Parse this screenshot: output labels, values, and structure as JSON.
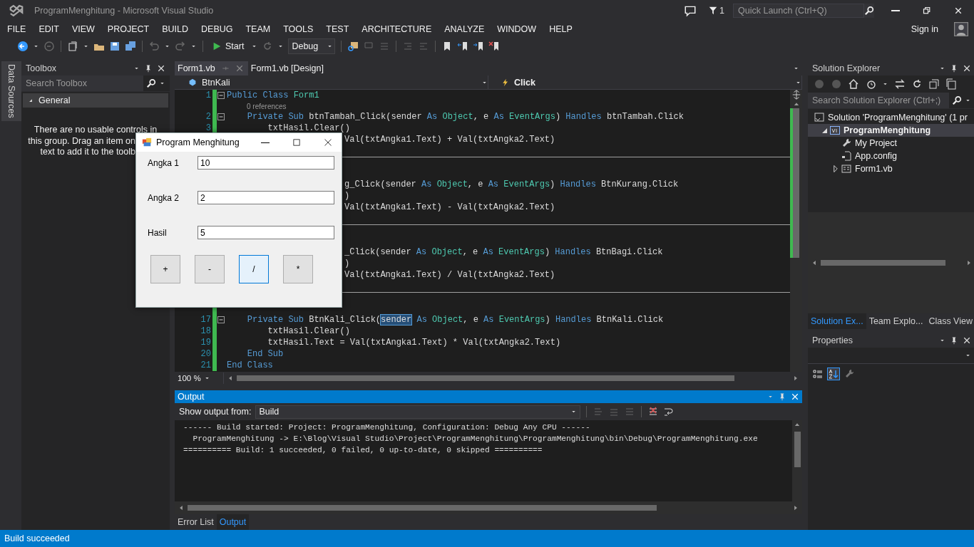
{
  "window": {
    "title": "ProgramMenghitung - Microsoft Visual Studio"
  },
  "title_bar": {
    "notification_count": "1",
    "quick_launch": {
      "placeholder": "Quick Launch (Ctrl+Q)"
    }
  },
  "menu": [
    "FILE",
    "EDIT",
    "VIEW",
    "PROJECT",
    "BUILD",
    "DEBUG",
    "TEAM",
    "TOOLS",
    "TEST",
    "ARCHITECTURE",
    "ANALYZE",
    "WINDOW",
    "HELP"
  ],
  "account": {
    "sign_in": "Sign in"
  },
  "toolbar": {
    "start": "Start",
    "configuration": "Debug"
  },
  "side_tabs": [
    "Data Sources"
  ],
  "toolbox": {
    "title": "Toolbox",
    "search": {
      "placeholder": "Search Toolbox"
    },
    "group": {
      "label": "General",
      "expanded": true
    },
    "message_lines": [
      "There are no usable controls in",
      "this group. Drag an item on",
      "text to add it to the toolb"
    ]
  },
  "editor": {
    "tabs": [
      {
        "label": "Form1.vb",
        "selected": true
      },
      {
        "label": "Form1.vb [Design]",
        "selected": false
      }
    ],
    "nav": {
      "member": "BtnKali",
      "event": "Click"
    },
    "lines": [
      {
        "kind": "code",
        "number": "1",
        "outline": true,
        "spans": [
          {
            "text": "Public Class ",
            "kind": "keyword"
          },
          {
            "text": "Form1",
            "kind": "type"
          }
        ]
      },
      {
        "kind": "codelens",
        "text": "0 references"
      },
      {
        "kind": "code",
        "number": "2",
        "outline": true,
        "spans": [
          {
            "text": "    Private Sub ",
            "kind": "keyword"
          },
          {
            "text": "btnTambah_Click(sender ",
            "kind": "plain"
          },
          {
            "text": "As ",
            "kind": "keyword"
          },
          {
            "text": "Object",
            "kind": "type"
          },
          {
            "text": ", e ",
            "kind": "plain"
          },
          {
            "text": "As ",
            "kind": "keyword"
          },
          {
            "text": "EventArgs",
            "kind": "type"
          },
          {
            "text": ") ",
            "kind": "plain"
          },
          {
            "text": "Handles ",
            "kind": "keyword"
          },
          {
            "text": "btnTambah.Click",
            "kind": "plain"
          }
        ]
      },
      {
        "kind": "code",
        "number": "3",
        "outline": false,
        "spans": [
          {
            "text": "        txtHasil.Clear()",
            "kind": "plain"
          }
        ]
      },
      {
        "kind": "covered",
        "spans": [
          {
            "text": "Val(txtAngka1.Text) + Val(txtAngka2.Text)",
            "kind": "plain"
          }
        ]
      },
      {
        "kind": "hidden"
      },
      {
        "kind": "separator"
      },
      {
        "kind": "hidden"
      },
      {
        "kind": "hidden_lens"
      },
      {
        "kind": "covered",
        "spans": [
          {
            "text": "g_Click(sender ",
            "kind": "plain"
          },
          {
            "text": "As ",
            "kind": "keyword"
          },
          {
            "text": "Object",
            "kind": "type"
          },
          {
            "text": ", e ",
            "kind": "plain"
          },
          {
            "text": "As ",
            "kind": "keyword"
          },
          {
            "text": "EventArgs",
            "kind": "type"
          },
          {
            "text": ") ",
            "kind": "plain"
          },
          {
            "text": "Handles ",
            "kind": "keyword"
          },
          {
            "text": "BtnKurang.Click",
            "kind": "plain"
          }
        ]
      },
      {
        "kind": "covered",
        "spans": [
          {
            "text": ")",
            "kind": "plain"
          }
        ]
      },
      {
        "kind": "covered",
        "spans": [
          {
            "text": "Val(txtAngka1.Text) - Val(txtAngka2.Text)",
            "kind": "plain"
          }
        ]
      },
      {
        "kind": "hidden"
      },
      {
        "kind": "separator"
      },
      {
        "kind": "hidden"
      },
      {
        "kind": "hidden_lens"
      },
      {
        "kind": "covered",
        "spans": [
          {
            "text": "_Click(sender ",
            "kind": "plain"
          },
          {
            "text": "As ",
            "kind": "keyword"
          },
          {
            "text": "Object",
            "kind": "type"
          },
          {
            "text": ", e ",
            "kind": "plain"
          },
          {
            "text": "As ",
            "kind": "keyword"
          },
          {
            "text": "EventArgs",
            "kind": "type"
          },
          {
            "text": ") ",
            "kind": "plain"
          },
          {
            "text": "Handles ",
            "kind": "keyword"
          },
          {
            "text": "BtnBagi.Click",
            "kind": "plain"
          }
        ]
      },
      {
        "kind": "covered",
        "spans": [
          {
            "text": ")",
            "kind": "plain"
          }
        ]
      },
      {
        "kind": "covered",
        "spans": [
          {
            "text": "Val(txtAngka1.Text) / Val(txtAngka2.Text)",
            "kind": "plain"
          }
        ]
      },
      {
        "kind": "hidden"
      },
      {
        "kind": "separator"
      },
      {
        "kind": "hidden"
      },
      {
        "kind": "hidden_lens"
      },
      {
        "kind": "code",
        "number": "17",
        "outline": true,
        "spans": [
          {
            "text": "    Private Sub ",
            "kind": "keyword"
          },
          {
            "text": "BtnKali_Click(",
            "kind": "plain"
          },
          {
            "text": "sender",
            "kind": "highlight"
          },
          {
            "text": " As ",
            "kind": "keyword"
          },
          {
            "text": "Object",
            "kind": "type"
          },
          {
            "text": ", e ",
            "kind": "plain"
          },
          {
            "text": "As ",
            "kind": "keyword"
          },
          {
            "text": "EventArgs",
            "kind": "type"
          },
          {
            "text": ") ",
            "kind": "plain"
          },
          {
            "text": "Handles ",
            "kind": "keyword"
          },
          {
            "text": "BtnKali.Click",
            "kind": "plain"
          }
        ]
      },
      {
        "kind": "code",
        "number": "18",
        "outline": false,
        "spans": [
          {
            "text": "        txtHasil.Clear()",
            "kind": "plain"
          }
        ]
      },
      {
        "kind": "code",
        "number": "19",
        "outline": false,
        "spans": [
          {
            "text": "        txtHasil.Text = Val(txtAngka1.Text) * Val(txtAngka2.Text)",
            "kind": "plain"
          }
        ]
      },
      {
        "kind": "code",
        "number": "20",
        "outline": false,
        "spans": [
          {
            "text": "    End Sub",
            "kind": "keyword"
          }
        ]
      },
      {
        "kind": "code",
        "number": "21",
        "outline": false,
        "spans": [
          {
            "text": "End Class",
            "kind": "keyword"
          }
        ]
      }
    ],
    "zoom": "100 %"
  },
  "form_window": {
    "title": "Program Menghitung",
    "fields": [
      {
        "label": "Angka 1",
        "value": "10"
      },
      {
        "label": "Angka 2",
        "value": "2"
      },
      {
        "label": "Hasil",
        "value": "5"
      }
    ],
    "buttons": [
      {
        "label": "+",
        "focused": false
      },
      {
        "label": "-",
        "focused": false
      },
      {
        "label": "/",
        "focused": true
      },
      {
        "label": "*",
        "focused": false
      }
    ]
  },
  "output": {
    "title": "Output",
    "source_label": "Show output from:",
    "source": "Build",
    "lines": [
      "------ Build started: Project: ProgramMenghitung, Configuration: Debug Any CPU ------",
      "  ProgramMenghitung -> E:\\Blog\\Visual Studio\\Project\\ProgramMenghitung\\ProgramMenghitung\\bin\\Debug\\ProgramMenghitung.exe",
      "========== Build: 1 succeeded, 0 failed, 0 up-to-date, 0 skipped =========="
    ]
  },
  "bottom_tabs": [
    {
      "label": "Error List",
      "selected": false
    },
    {
      "label": "Output",
      "selected": true
    }
  ],
  "solution_explorer": {
    "title": "Solution Explorer",
    "search": {
      "placeholder": "Search Solution Explorer (Ctrl+;)"
    },
    "tree": [
      {
        "label": "Solution 'ProgramMenghitung' (1 pr",
        "kind": "solution",
        "selected": false,
        "children": [
          {
            "label": "ProgramMenghitung",
            "kind": "project",
            "selected": true,
            "expanded": true,
            "children": [
              {
                "label": "My Project",
                "kind": "properties",
                "selected": false
              },
              {
                "label": "App.config",
                "kind": "config",
                "selected": false
              },
              {
                "label": "Form1.vb",
                "kind": "form",
                "selected": false,
                "expanded": false
              }
            ]
          }
        ]
      }
    ]
  },
  "panel_tabs": [
    {
      "label": "Solution Ex...",
      "selected": true
    },
    {
      "label": "Team Explo...",
      "selected": false
    },
    {
      "label": "Class View",
      "selected": false
    }
  ],
  "properties": {
    "title": "Properties"
  },
  "status_bar": {
    "text": "Build succeeded"
  }
}
